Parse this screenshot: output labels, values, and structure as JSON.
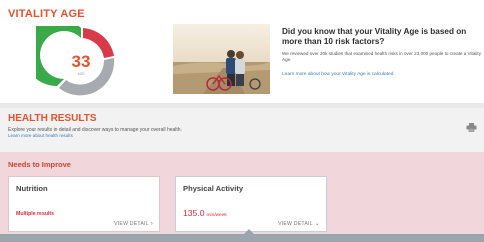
{
  "vitality": {
    "title": "VITALITY AGE",
    "age": "33",
    "age_sub": "AGE",
    "colors": {
      "green": "#39a949",
      "red": "#d93a4a",
      "gray": "#a7abb0",
      "orange": "#e5532d"
    }
  },
  "callout": {
    "title": "Did you know that your Vitality Age is based on more than 10 risk factors?",
    "body": "We reviewed over 20k studies that examined health risks in over 23,000 people to create a Vitality Age.",
    "link": "Learn more about how your Vitality Age is calculated"
  },
  "health_results": {
    "title": "HEALTH RESULTS",
    "description": "Explore your results in detail and discover ways to manage your overall health.",
    "link": "Learn more about health results"
  },
  "needs_improve": {
    "title": "Needs to Improve",
    "cards": [
      {
        "title": "Nutrition",
        "status": "Multiple results",
        "link": "VIEW DETAIL",
        "chevron": "›"
      },
      {
        "title": "Physical Activity",
        "value": "135.0",
        "unit": "min/week",
        "link": "VIEW DETAIL",
        "chevron": "⌄"
      }
    ]
  }
}
